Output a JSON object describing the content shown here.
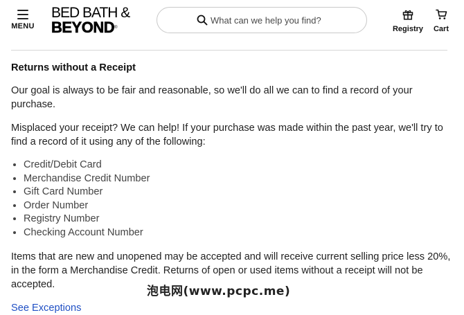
{
  "header": {
    "menu_label": "MENU",
    "logo_line1": "BED BATH &",
    "logo_line2": "BEYOND",
    "logo_reg": "®",
    "search_placeholder": "What can we help you find?",
    "registry_label": "Registry",
    "cart_label": "Cart"
  },
  "article": {
    "heading": "Returns without a Receipt",
    "para1": "Our goal is always to be fair and reasonable, so we'll do all we can to find a record of your purchase.",
    "para2": "Misplaced your receipt? We can help! If your purchase was made within the past year, we'll try to find a record of it using any of the following:",
    "items": [
      "Credit/Debit Card",
      "Merchandise Credit Number",
      "Gift Card Number",
      "Order Number",
      "Registry Number",
      "Checking Account Number"
    ],
    "para3": "Items that are new and unopened may be accepted and will receive current selling price less 20%, in the form a Merchandise Credit. Returns of open or used items without a receipt will not be accepted.",
    "link": "See Exceptions"
  },
  "watermark": "泡电网(www.pcpc.me)",
  "colors": {
    "link": "#1f4fc4",
    "text": "#222222",
    "border": "#c9c9c9"
  }
}
